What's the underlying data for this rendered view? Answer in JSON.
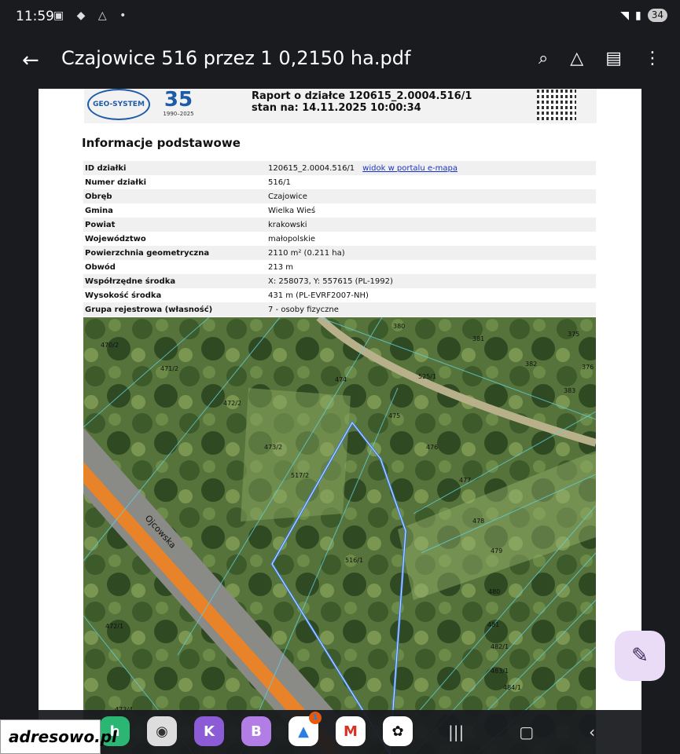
{
  "status": {
    "time": "11:59",
    "battery": "34"
  },
  "appbar": {
    "title": "Czajowice 516 przez 1  0,2150 ha.pdf"
  },
  "header": {
    "logo": "GEO-SYSTEM",
    "years_big": "35",
    "years_small": "1990–2025",
    "report": "Raport o działce 120615_2.0004.516/1",
    "date": "stan na: 14.11.2025 10:00:34"
  },
  "section": "Informacje podstawowe",
  "rows": [
    {
      "k": "ID działki",
      "v": "120615_2.0004.516/1",
      "link": "widok w portalu e-mapa"
    },
    {
      "k": "Numer działki",
      "v": "516/1"
    },
    {
      "k": "Obręb",
      "v": "Czajowice"
    },
    {
      "k": "Gmina",
      "v": "Wielka Wieś"
    },
    {
      "k": "Powiat",
      "v": "krakowski"
    },
    {
      "k": "Województwo",
      "v": "małopolskie"
    },
    {
      "k": "Powierzchnia geometryczna",
      "v": "2110 m² (0.211 ha)"
    },
    {
      "k": "Obwód",
      "v": "213 m"
    },
    {
      "k": "Współrzędne środka",
      "v": "X: 258073, Y: 557615 (PL-1992)"
    },
    {
      "k": "Wysokość środka",
      "v": "431 m (PL-EVRF2007-NH)"
    },
    {
      "k": "Grupa rejestrowa (własność)",
      "v": "7 - osoby fizyczne"
    }
  ],
  "map": {
    "road": "Ojcowska",
    "parcels": [
      "470/2",
      "471/2",
      "472/2",
      "473/2",
      "474",
      "475",
      "476",
      "477",
      "478",
      "479",
      "480",
      "481",
      "482/1",
      "483/1",
      "484/1",
      "485/1",
      "380",
      "381",
      "382",
      "383",
      "375",
      "376",
      "525/1",
      "517/2",
      "516/1",
      "472/1",
      "473/4"
    ]
  },
  "watermark": "adresowo.pl",
  "nav": {
    "badge": "1"
  }
}
